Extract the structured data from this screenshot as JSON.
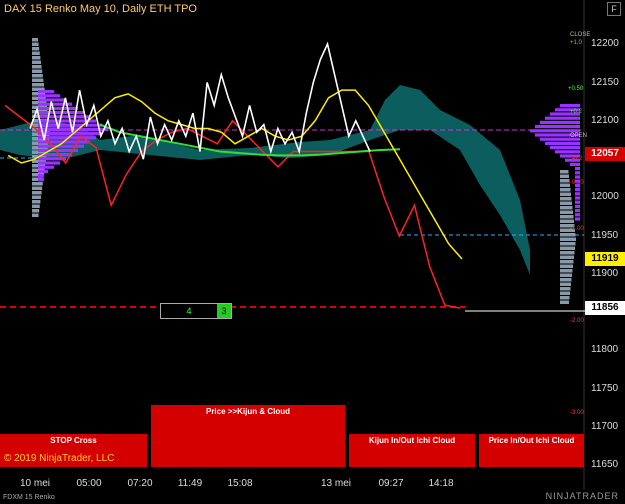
{
  "title": "DAX 15 Renko May 10, Daily ETH TPO",
  "menu_button": "F",
  "copyright": "© 2019 NinjaTrader, LLC",
  "instrument_label": "FDXM 15 Renko",
  "brand": "NINJATRADER",
  "position": {
    "quantity": "4",
    "indicator": "3"
  },
  "buttons": {
    "stop_cross": "STOP Cross",
    "price_kijun_cloud": "Price >>Kijun & Cloud",
    "kijun_in_out": "Kijun In/Out Ichi Cloud",
    "price_in_out": "Price In/Out Ichi Cloud"
  },
  "price_tags": {
    "red": "12057",
    "yellow": "11919",
    "white": "11856"
  },
  "side_labels": [
    "CLOSE",
    "+1.0",
    "+0.50",
    "+0.2",
    "OPEN",
    "-0.2",
    "-0.50",
    "-1.00",
    "-2.00",
    "-3.00"
  ],
  "colors": {
    "background": "#000000",
    "tenkan": "#ff2222",
    "kijun": "#ffee00",
    "price_line": "#ffffff",
    "ma_line": "#33dd33",
    "cloud": "#0e6e6e",
    "tpo": "#9933ff",
    "poc_line": "#cc33cc",
    "va_line": "#33aaff"
  },
  "chart_data": {
    "type": "line",
    "title": "DAX 15 Renko May 10, Daily ETH TPO",
    "y_ticks": [
      12200,
      12150,
      12100,
      12050,
      12000,
      11950,
      11900,
      11850,
      11800,
      11750,
      11700,
      11650
    ],
    "ylim": [
      11640,
      12240
    ],
    "x_ticks": [
      "10 mei",
      "05:00",
      "07:20",
      "11:49",
      "15:08",
      "13 mei",
      "09:27",
      "14:18"
    ],
    "grid": false,
    "series": [
      {
        "values": [
          12090,
          12115,
          12075,
          12125,
          12090,
          12130,
          12085,
          12140,
          12095,
          12120,
          12080,
          12100,
          12070,
          12090,
          12060,
          12080,
          12050,
          12105,
          12070,
          12095,
          12075,
          12100,
          12080,
          12110,
          12060,
          12150,
          12120,
          12160,
          12130,
          12105,
          12080,
          12120,
          12085,
          12095,
          12060,
          12090,
          12070,
          12085,
          12060,
          12110,
          12150,
          12180,
          12200,
          12160,
          12120,
          12080,
          12100,
          12080,
          12060
        ]
      },
      {
        "values": [
          12055,
          12045,
          12050,
          12060,
          12070,
          12085,
          12100,
          12115,
          12130,
          12135,
          12125,
          12110,
          12100,
          12095,
          12090,
          12090,
          12085,
          12070,
          12080,
          12090,
          12080,
          12075,
          12080,
          12100,
          12130,
          12140,
          12140,
          12120,
          12090,
          12060,
          12030,
          12000,
          11970,
          11940,
          11920
        ]
      },
      {
        "values": [
          12120,
          12105,
          12090,
          12070,
          12045,
          12080,
          12065,
          11990,
          12030,
          12060,
          12075,
          12085,
          12090,
          12080,
          12070,
          12100,
          12080,
          12060,
          12040,
          12060,
          12060,
          12060,
          12060,
          12060,
          12060,
          12000,
          11950,
          11990,
          11910,
          11860,
          11856
        ]
      },
      {
        "values": [
          12095,
          12085,
          12080,
          12075,
          12070,
          12065,
          12060,
          12058,
          12056,
          12055,
          12055,
          12056,
          12058,
          12060,
          12062,
          12063
        ]
      }
    ]
  }
}
